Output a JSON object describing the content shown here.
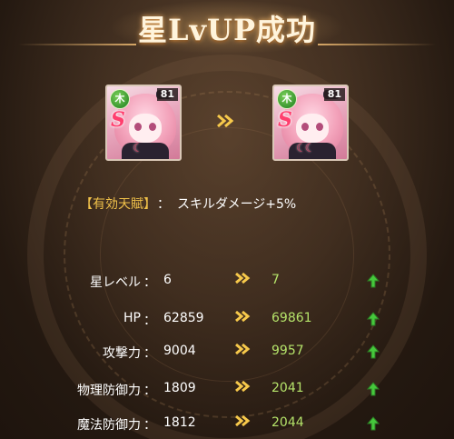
{
  "title": "星LvUP成功",
  "cards": {
    "before": {
      "element": "木",
      "level": "81",
      "rarity": "S",
      "moons": "☾"
    },
    "after": {
      "element": "木",
      "level": "81",
      "rarity": "S",
      "moons": "☾☾"
    }
  },
  "talent": {
    "tag": "【有効天賦】",
    "separator": "：",
    "text": "スキルダメージ+5%"
  },
  "stats": [
    {
      "label": "星レベル",
      "colon": "：",
      "old": "6",
      "new": "7"
    },
    {
      "label": "HP",
      "colon": "：",
      "old": "62859",
      "new": "69861"
    },
    {
      "label": "攻撃力",
      "colon": "：",
      "old": "9004",
      "new": "9957"
    },
    {
      "label": "物理防御力",
      "colon": "：",
      "old": "1809",
      "new": "2041"
    },
    {
      "label": "魔法防御力",
      "colon": "：",
      "old": "1812",
      "new": "2044"
    }
  ],
  "colors": {
    "accent_gold": "#f7c94b",
    "increase_green": "#b5e36a",
    "talent_tag": "#f1c24a"
  },
  "icons": {
    "transition_arrow": "double-chevron-right-icon",
    "increase": "green-up-arrow-icon",
    "element": "wood-element-icon"
  }
}
